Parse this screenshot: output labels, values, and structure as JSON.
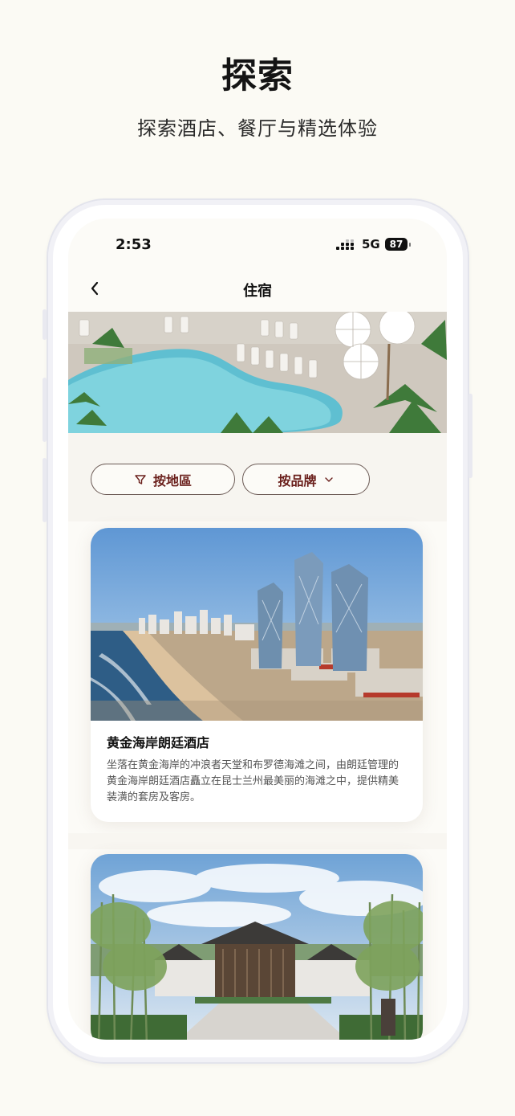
{
  "page": {
    "title": "探索",
    "subtitle": "探索酒店、餐厅与精选体验"
  },
  "status_bar": {
    "time": "2:53",
    "network": "5G",
    "battery": "87"
  },
  "nav": {
    "back_icon": "chevron-left-icon",
    "title": "住宿"
  },
  "filters": {
    "region_label": "按地區",
    "region_icon": "filter-funnel-icon",
    "brand_label": "按品牌",
    "brand_icon": "chevron-down-icon"
  },
  "hotels": [
    {
      "name": "黄金海岸朗廷酒店",
      "description": "坐落在黄金海岸的冲浪者天堂和布罗德海滩之间，由朗廷管理的黄金海岸朗廷酒店矗立在昆士兰州最美丽的海滩之中，提供精美装潢的套房及客房。"
    },
    {
      "name": "",
      "description": ""
    }
  ],
  "colors": {
    "background": "#fbfaf4",
    "accent": "#6a1f1b",
    "chip_border": "#6b5a55"
  }
}
